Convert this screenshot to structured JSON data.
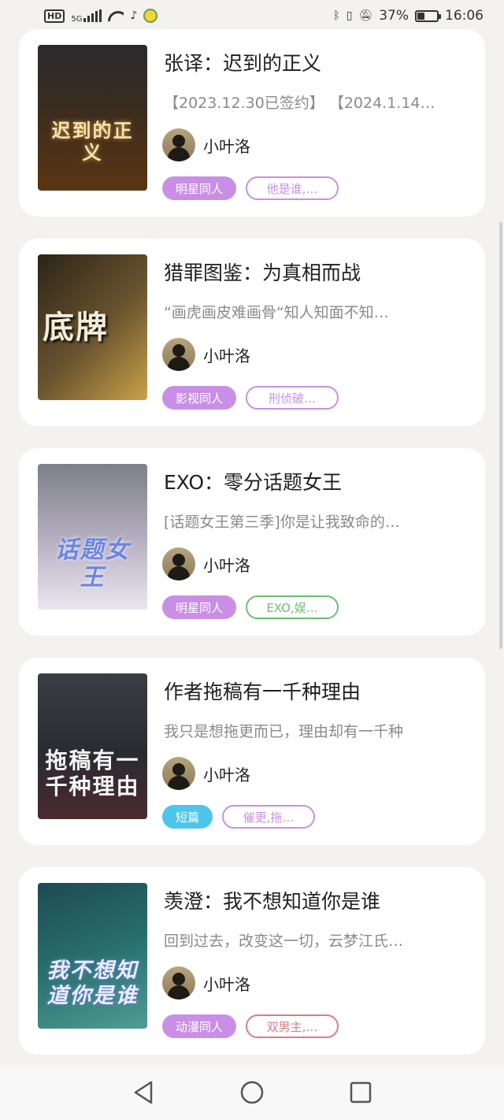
{
  "status_bar": {
    "hd": "HD",
    "network": "5G",
    "battery_percent": "37%",
    "battery_level": 0.37,
    "time": "16:06",
    "icons": [
      "hd-icon",
      "signal-icon",
      "wifi-icon",
      "music-note-icon",
      "app-mascot-icon",
      "bluetooth-icon",
      "vibrate-icon",
      "mute-bell-icon",
      "battery-icon"
    ]
  },
  "books": [
    {
      "title": "张译：迟到的正义",
      "description": "【2023.12.30已签约】 【2024.1.14…",
      "cover_text": "迟到的正义",
      "author": "小叶洛",
      "tags": [
        {
          "label": "明星同人",
          "style": "fill",
          "color": "#c98fe6"
        },
        {
          "label": "他是谁,…",
          "style": "outline",
          "color": "#c98fe6"
        }
      ]
    },
    {
      "title": "猎罪图鉴：为真相而战",
      "description": "“画虎画皮难画骨“知人知面不知…",
      "cover_text": "底牌",
      "author": "小叶洛",
      "tags": [
        {
          "label": "影视同人",
          "style": "fill",
          "color": "#c98fe6"
        },
        {
          "label": "刑侦破…",
          "style": "outline",
          "color": "#c98fe6"
        }
      ]
    },
    {
      "title": "EXO：零分话题女王",
      "description": "[话题女王第三季]你是让我致命的…",
      "cover_text": "话题女王",
      "author": "小叶洛",
      "tags": [
        {
          "label": "明星同人",
          "style": "fill",
          "color": "#c98fe6"
        },
        {
          "label": "EXO,娱…",
          "style": "outline",
          "color": "#6cc070"
        }
      ]
    },
    {
      "title": "作者拖稿有一千种理由",
      "description": "我只是想拖更而已，理由却有一千种",
      "cover_text": "拖稿有一千种理由",
      "author": "小叶洛",
      "tags": [
        {
          "label": "短篇",
          "style": "fill",
          "color": "#4cc6ea"
        },
        {
          "label": "催更,拖…",
          "style": "outline",
          "color": "#c98fe6"
        }
      ]
    },
    {
      "title": "羡澄：我不想知道你是谁",
      "description": "回到过去，改变这一切，云梦江氏…",
      "cover_text": "我不想知道你是谁",
      "author": "小叶洛",
      "tags": [
        {
          "label": "动漫同人",
          "style": "fill",
          "color": "#c98fe6"
        },
        {
          "label": "双男主,…",
          "style": "outline",
          "color": "#e07a86"
        }
      ]
    }
  ],
  "nav_bar": {
    "icons": [
      "back-triangle-icon",
      "home-circle-icon",
      "recents-square-icon"
    ]
  }
}
